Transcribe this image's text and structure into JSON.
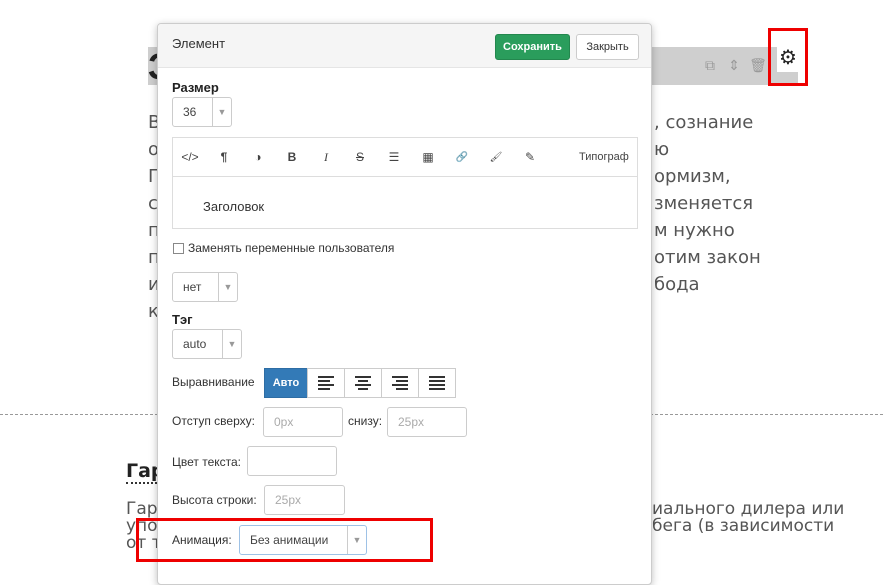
{
  "background": {
    "heading_fragment": "З",
    "paragraph_left": [
      "В",
      "о",
      "П",
      "с",
      "п",
      "п",
      "и",
      "к"
    ],
    "paragraph_right": [
      ", сознание",
      "ю",
      "ормизм,",
      "зменяется",
      "м нужно",
      "отим закон",
      "бода"
    ],
    "section_heading": "Гар",
    "bottom_lines": [
      {
        "left": "Гара",
        "right": "иального дилера или"
      },
      {
        "left": "упол",
        "right": "бега (в зависимости"
      },
      {
        "left": "от то",
        "right": ""
      }
    ]
  },
  "modal": {
    "title": "Элемент",
    "save_label": "Сохранить",
    "close_label": "Закрыть",
    "size_label": "Размер",
    "size_value": "36",
    "toolbar": {
      "code": "</>",
      "para": "¶",
      "contrast": "◑",
      "bold": "B",
      "italic": "I",
      "strike": "S",
      "list": "☰",
      "table": "▦",
      "link": "🔗",
      "brush": "🖌",
      "pencil": "✎",
      "typograph": "Типограф"
    },
    "editor_text": "Заголовок",
    "replace_vars_label": "Заменять переменные пользователя",
    "net_value": "нет",
    "tag_label": "Тэг",
    "tag_value": "auto",
    "align_label": "Выравнивание",
    "align_auto": "Авто",
    "margin_top_label": "Отступ сверху:",
    "margin_top_placeholder": "0px",
    "margin_bottom_label": "снизу:",
    "margin_bottom_placeholder": "25px",
    "text_color_label": "Цвет текста:",
    "line_height_label": "Высота строки:",
    "line_height_placeholder": "25px",
    "animation_label": "Анимация:",
    "animation_value": "Без анимации"
  },
  "colors": {
    "save_green": "#2a9d5c",
    "active_blue": "#337ab7",
    "highlight_red": "#e00000"
  }
}
